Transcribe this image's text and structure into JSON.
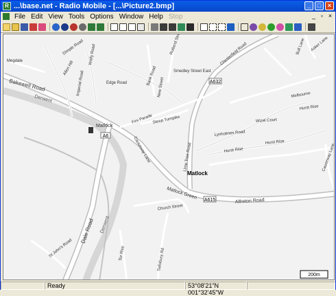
{
  "window": {
    "title": "...\\base.net - Radio Mobile - [...\\Picture2.bmp]"
  },
  "menu": [
    "File",
    "Edit",
    "View",
    "Tools",
    "Options",
    "Window",
    "Help"
  ],
  "menu_disabled": "Stop",
  "map": {
    "labels": {
      "bakewell_road": "Bakewell Road",
      "derwent": "Derwent",
      "derwent2": "Derwent",
      "matlock_small": "Matlock",
      "matlock": "Matlock",
      "dale_road": "Dale Road",
      "edge_road": "Edge Road",
      "bank_road": "Bank Road",
      "smedley_street_east": "Smedley Street East",
      "rutland_street": "Rutland Street",
      "chesterfield_road": "Chesterfield Road",
      "steep_turnpike": "Steep Turnpike",
      "lime_tree_road": "Lime Tree Road",
      "lynholmes_road": "Lynholmes Road",
      "hurst_rise": "Hurst Rise",
      "hurst_rise2": "Hurst Rise",
      "hurst_rise3": "Hurst Rise",
      "matlock_green": "Matlock Green",
      "alfreton_road": "Alfreton Road",
      "church_street": "Church Street",
      "causeway_lane": "Causeway Lane",
      "firs_parade": "Firs Parade",
      "st_johns_road": "St John's Road",
      "allen_hill": "Allen Hill",
      "dimple_road": "Dimple Road",
      "wolfy_road": "Wolfy Road",
      "megdale": "Megdale",
      "a6": "A6",
      "a632": "A632",
      "a615": "A615",
      "melbourne": "Melbourne",
      "wizel_court": "Wizel Court",
      "tor_rise": "Tor Rise",
      "new_street": "New Street",
      "imperial_road": "Imperial Road",
      "salisbury": "Salisbury Rd",
      "bull_lane": "Bull Lane",
      "asker_lane": "Asker Lane",
      "causeway_lane2": "Causeway Lane",
      "scale": "200m"
    }
  },
  "status": {
    "state": "Ready",
    "coords": "53°08'21\"N 001°32'45\"W"
  }
}
